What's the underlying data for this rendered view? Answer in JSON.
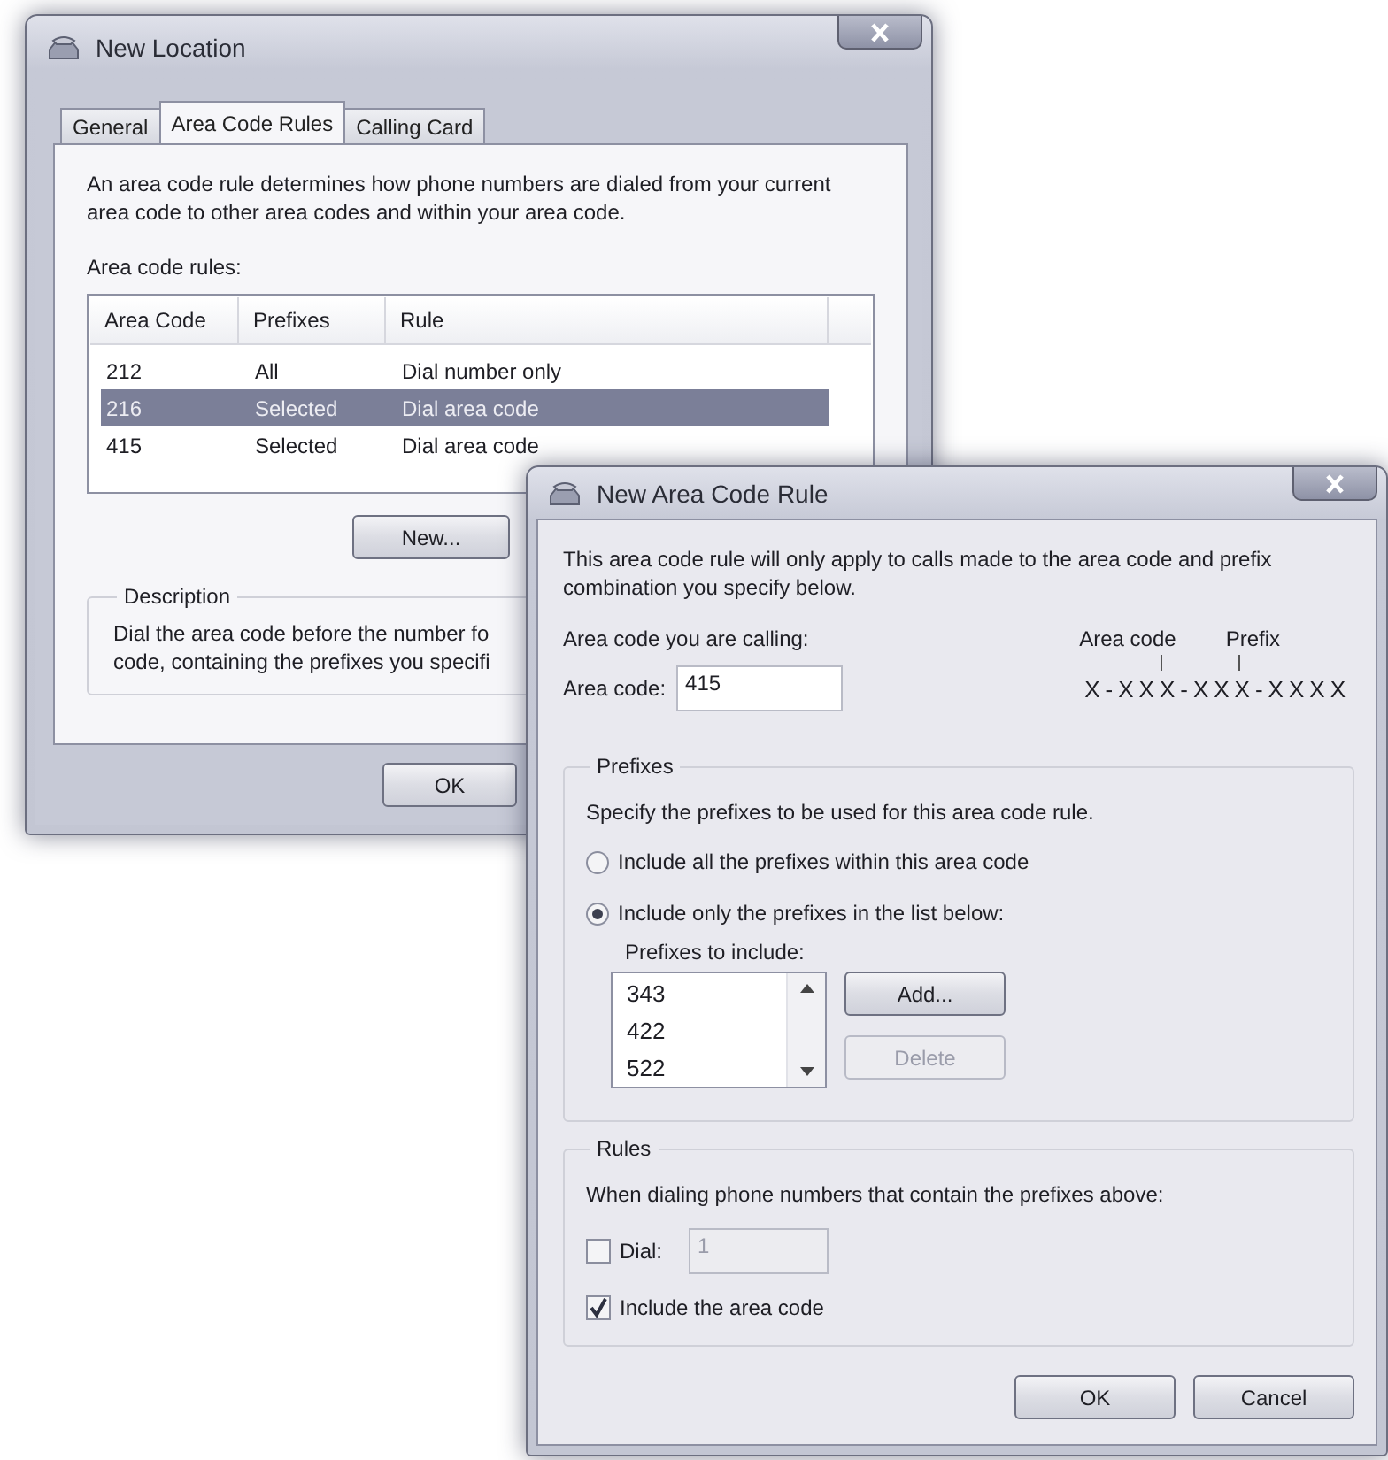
{
  "location_window": {
    "title": "New Location",
    "tabs": [
      {
        "label": "General",
        "selected": false
      },
      {
        "label": "Area Code Rules",
        "selected": true
      },
      {
        "label": "Calling Card",
        "selected": false
      }
    ],
    "intro": "An area code rule determines how phone numbers are dialed from your current area code to other area codes and within your area code.",
    "rules_label": "Area code rules:",
    "table": {
      "columns": [
        "Area Code",
        "Prefixes",
        "Rule"
      ],
      "rows": [
        {
          "cells": [
            "212",
            "All",
            "Dial number only"
          ],
          "selected": false
        },
        {
          "cells": [
            "216",
            "Selected",
            "Dial area code"
          ],
          "selected": true
        },
        {
          "cells": [
            "415",
            "Selected",
            "Dial area code"
          ],
          "selected": false
        }
      ]
    },
    "new_button": "New...",
    "description": {
      "title": "Description",
      "lines": [
        "Dial the area code before the number fo",
        "code, containing the prefixes you specifi"
      ]
    },
    "ok_button": "OK"
  },
  "rule_window": {
    "title": "New Area Code Rule",
    "intro": "This area code rule will only apply to calls made to the area code and prefix combination you specify below.",
    "calling_label": "Area code you are calling:",
    "area_code": {
      "label": "Area code:",
      "value": "415"
    },
    "diagram": {
      "area_code_label": "Area code",
      "prefix_label": "Prefix",
      "pattern": "X-XXX-XXX-XXXX"
    },
    "prefixes": {
      "title": "Prefixes",
      "instruction": "Specify the prefixes to be used for this area code rule.",
      "options": [
        {
          "label": "Include all the prefixes within this area code",
          "selected": false
        },
        {
          "label": "Include only the prefixes in the list below:",
          "selected": true
        }
      ],
      "list_label": "Prefixes to include:",
      "items": [
        "343",
        "422",
        "522"
      ],
      "add_button": {
        "label": "Add...",
        "disabled": false
      },
      "delete_button": {
        "label": "Delete",
        "disabled": true
      }
    },
    "rules": {
      "title": "Rules",
      "instruction": "When dialing phone numbers that contain the prefixes above:",
      "dial": {
        "label": "Dial:",
        "checked": false,
        "value": "1",
        "disabled": true
      },
      "include_area_code": {
        "label": "Include the area code",
        "checked": true
      }
    },
    "buttons": [
      "OK",
      "Cancel"
    ]
  }
}
